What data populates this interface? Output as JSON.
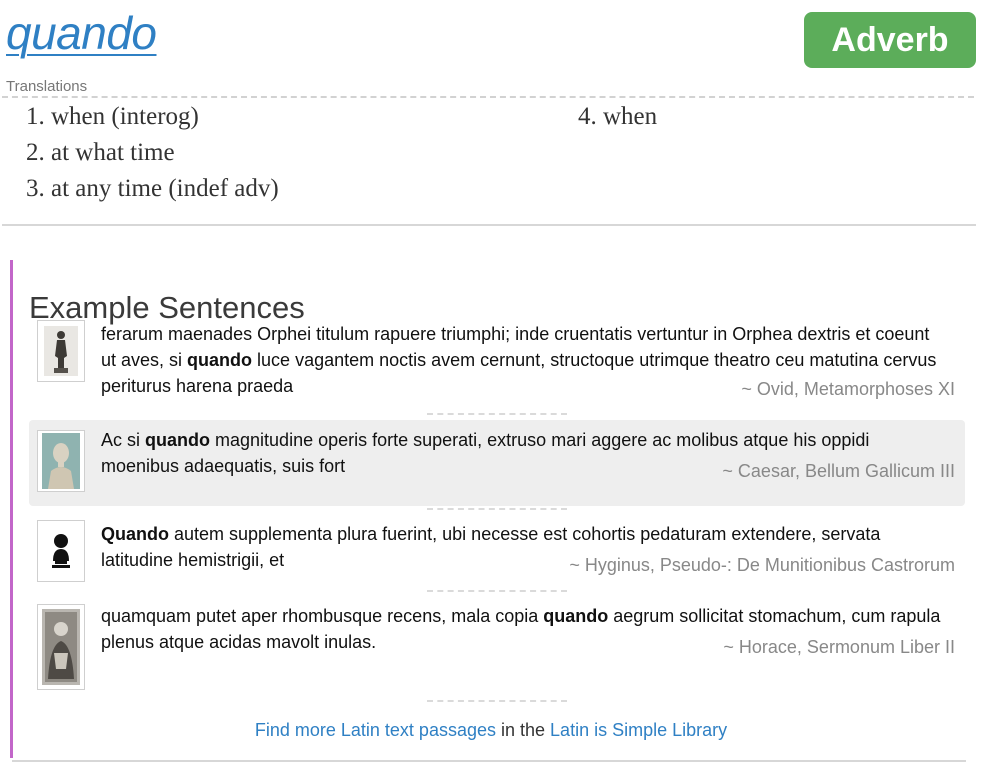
{
  "headword": "quando",
  "part_of_speech": "Adverb",
  "translations_label": "Translations",
  "translations_left": [
    "1. when (interog)",
    "2. at what time",
    "3. at any time (indef adv)"
  ],
  "translations_right": [
    "4. when"
  ],
  "examples_title": "Example Sentences",
  "examples": [
    {
      "pre": "ferarum maenades Orphei titulum rapuere triumphi; inde cruentatis vertuntur in Orphea dextris et coeunt ut aves, si ",
      "keyword": "quando",
      "post": " luce vagantem noctis avem cernunt, structoque utrimque theatro ceu matutina cervus periturus harena praeda",
      "source": "~ Ovid, Metamorphoses XI",
      "thumbnail_icon": "statue-icon"
    },
    {
      "pre": "Ac si ",
      "keyword": "quando",
      "post": " magnitudine operis forte superati, extruso mari aggere ac molibus atque his oppidi moenibus adaequatis, suis fort",
      "source": "~ Caesar, Bellum Gallicum III",
      "thumbnail_icon": "portrait-bust-icon"
    },
    {
      "pre": "",
      "keyword": "Quando",
      "post": " autem supplementa plura fuerint, ubi necesse est cohortis pedaturam extendere, servata latitudine hemistrigii, et",
      "source": "~ Hyginus, Pseudo-: De Munitionibus Castrorum",
      "thumbnail_icon": "bust-silhouette-icon"
    },
    {
      "pre": "quamquam putet aper rhombusque recens, mala copia ",
      "keyword": "quando",
      "post": " aegrum sollicitat stomachum, cum rapula plenus atque acidas mavolt inulas.",
      "source": "~ Horace, Sermonum Liber II",
      "thumbnail_icon": "engraving-portrait-icon"
    }
  ],
  "footer": {
    "link1": "Find more Latin text passages",
    "middle": " in the ",
    "link2": "Latin is Simple Library"
  },
  "colors": {
    "link": "#2f80c4",
    "badge": "#5cad5a",
    "examples_border": "#c266c9",
    "highlight_row": "#eeeeee"
  }
}
